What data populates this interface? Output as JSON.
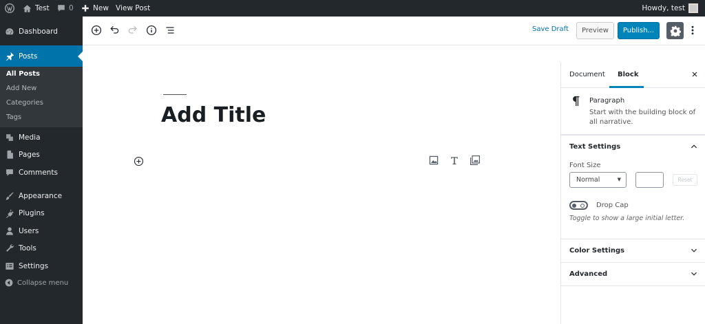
{
  "admin_bar": {
    "logo_icon": "wordpress-icon",
    "site_name": "Test",
    "comments_count": "0",
    "new_label": "New",
    "view_post_label": "View Post",
    "howdy": "Howdy, test"
  },
  "sidebar": {
    "items": [
      {
        "label": "Dashboard",
        "icon": "dashboard-icon"
      },
      {
        "label": "Posts",
        "icon": "pin-icon",
        "active": true
      },
      {
        "label": "Media",
        "icon": "media-icon"
      },
      {
        "label": "Pages",
        "icon": "pages-icon"
      },
      {
        "label": "Comments",
        "icon": "comment-icon"
      },
      {
        "label": "Appearance",
        "icon": "brush-icon"
      },
      {
        "label": "Plugins",
        "icon": "plugin-icon"
      },
      {
        "label": "Users",
        "icon": "user-icon"
      },
      {
        "label": "Tools",
        "icon": "wrench-icon"
      },
      {
        "label": "Settings",
        "icon": "settings-icon"
      }
    ],
    "submenu": [
      "All Posts",
      "Add New",
      "Categories",
      "Tags"
    ],
    "collapse_label": "Collapse menu"
  },
  "toolbar": {
    "save_draft": "Save Draft",
    "preview": "Preview",
    "publish": "Publish..."
  },
  "editor": {
    "title_placeholder": "Add Title"
  },
  "panel": {
    "tabs": [
      "Document",
      "Block"
    ],
    "block_name": "Paragraph",
    "block_description": "Start with the building block of all narrative.",
    "text_settings_title": "Text Settings",
    "font_size_label": "Font Size",
    "font_size_value": "Normal",
    "reset_label": "Reset",
    "drop_cap_label": "Drop Cap",
    "drop_cap_help": "Toggle to show a large initial letter.",
    "color_settings_title": "Color Settings",
    "advanced_title": "Advanced"
  },
  "colors": {
    "admin_bg": "#23282d",
    "accent": "#0073aa",
    "publish": "#0085ba"
  }
}
